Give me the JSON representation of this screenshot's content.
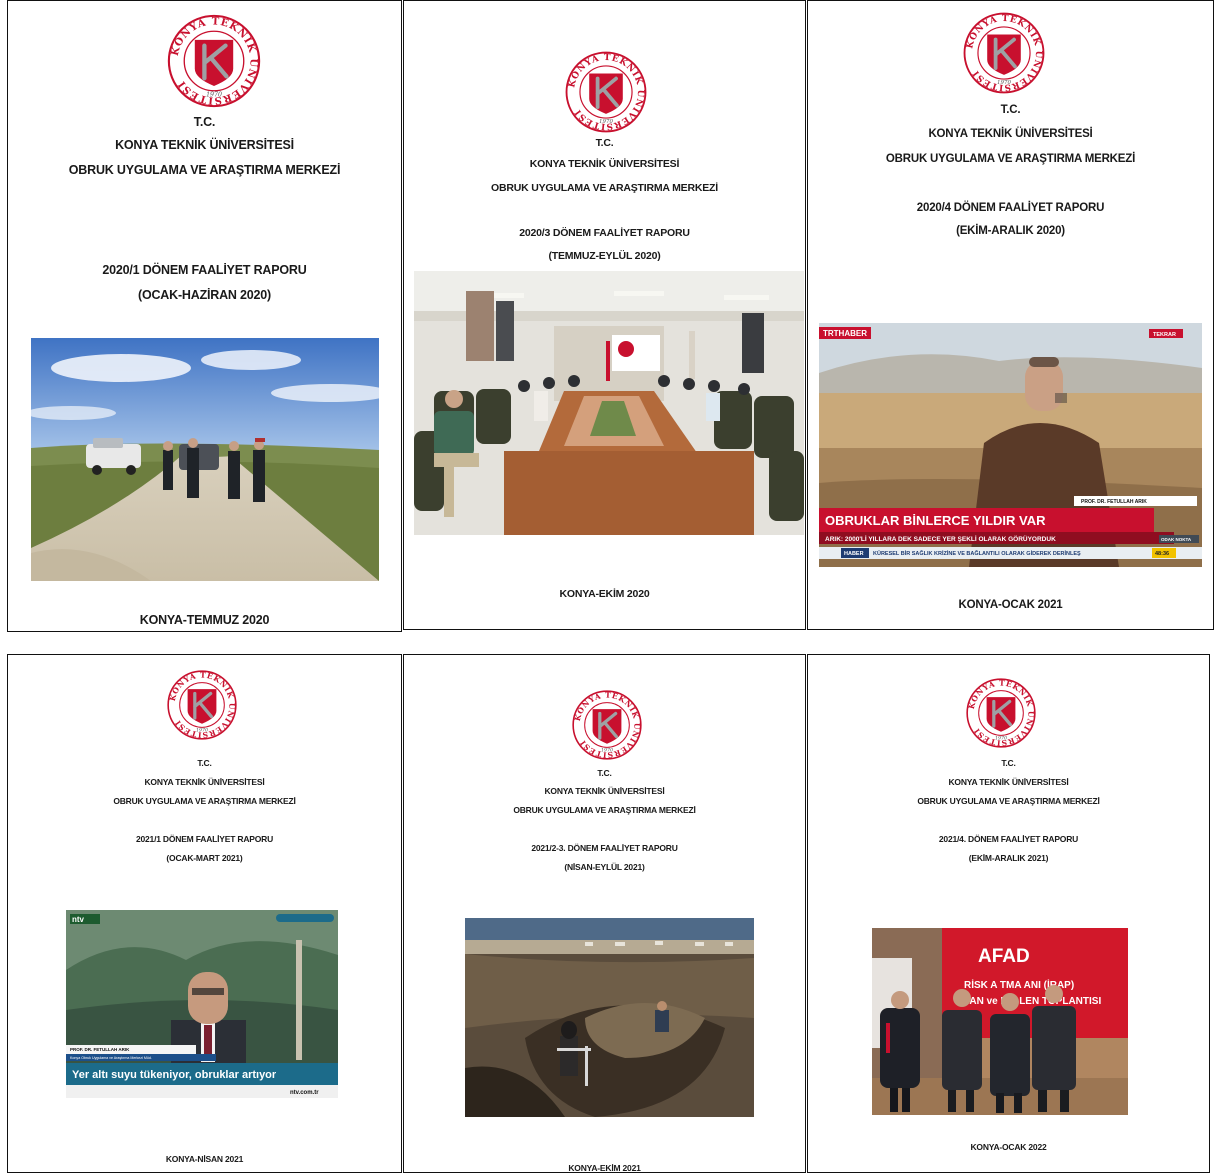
{
  "logo": {
    "ring_text": "KONYA TEKNİK ÜNİVERSİTESİ",
    "year": "1970",
    "color_red": "#c8102e",
    "color_gray": "#9ea1a4"
  },
  "common": {
    "tc": "T.C.",
    "university": "KONYA TEKNİK ÜNİVERSİTESİ",
    "center": "OBRUK UYGULAMA VE ARAŞTIRMA MERKEZİ"
  },
  "reports": [
    {
      "title": "2020/1 DÖNEM FAALİYET RAPORU",
      "period": "(OCAK-HAZİRAN 2020)",
      "footer": "KONYA-TEMMUZ 2020"
    },
    {
      "title": "2020/3 DÖNEM FAALİYET RAPORU",
      "period": "(TEMMUZ-EYLÜL 2020)",
      "footer": "KONYA-EKİM 2020"
    },
    {
      "title": "2020/4 DÖNEM FAALİYET RAPORU",
      "period": "(EKİM-ARALIK 2020)",
      "footer": "KONYA-OCAK 2021"
    },
    {
      "title": "2021/1 DÖNEM FAALİYET RAPORU",
      "period": "(OCAK-MART 2021)",
      "footer": "KONYA-NİSAN 2021"
    },
    {
      "title": "2021/2-3. DÖNEM FAALİYET RAPORU",
      "period": "(NİSAN-EYLÜL 2021)",
      "footer": "KONYA-EKİM 2021"
    },
    {
      "title": "2021/4. DÖNEM FAALİYET RAPORU",
      "period": "(EKİM-ARALIK 2021)",
      "footer": "KONYA-OCAK 2022"
    }
  ],
  "photo3": {
    "channel": "TRTHABER",
    "corner": "TEKRAR",
    "name": "PROF. DR. FETULLAH ARIK",
    "headline": "OBRUKLAR BİNLERCE YILDIR VAR",
    "subline": "ARIK: 2000'Lİ YILLARA DEK SADECE YER ŞEKLİ OLARAK GÖRÜYORDUK",
    "tag": "HABER",
    "ticker": "KÜRESEL BİR SAĞLIK KRİZİNE VE BAĞLANTILI OLARAK GİDEREK DERİNLEŞ",
    "time": "48:36",
    "badge": "ODAK NOKTA"
  },
  "photo4": {
    "channel": "ntv",
    "name": "PROF. DR. FETULLAH ARIK",
    "role": "Konya Obruk Uygulama ve Araştırma Merkezi Müd.",
    "caption": "Yer altı suyu tükeniyor, obruklar artıyor",
    "site": "ntv.com.tr"
  },
  "photo6": {
    "brand": "AFAD",
    "line1": "RİSK A  TMA  ANI (İRAP)",
    "line2": "TAN  ve BİL  LEN    TOPLANTISI"
  }
}
